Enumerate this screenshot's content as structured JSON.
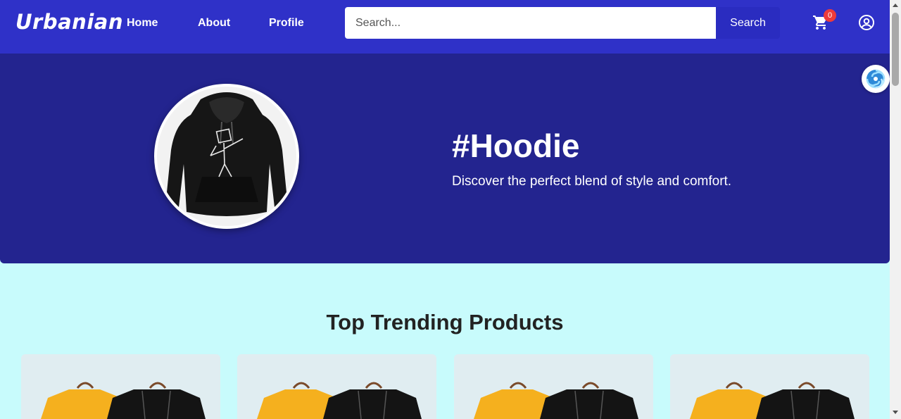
{
  "navbar": {
    "logo": "Urbanian",
    "links": [
      "Home",
      "About",
      "Profile"
    ],
    "search_placeholder": "Search...",
    "search_button": "Search",
    "cart_count": "0",
    "bg_color": "#2f31c8"
  },
  "hero": {
    "title": "#Hoodie",
    "subtitle": "Discover the perfect blend of style and comfort.",
    "bg_color": "#23248f"
  },
  "trending": {
    "title": "Top Trending Products",
    "products": [
      {
        "icon": "tshirts-image"
      },
      {
        "icon": "tshirts-image"
      },
      {
        "icon": "tshirts-image"
      },
      {
        "icon": "tshirts-image"
      }
    ]
  },
  "colors": {
    "page_bg": "#c8fbfc",
    "badge": "#ee3b3b"
  }
}
